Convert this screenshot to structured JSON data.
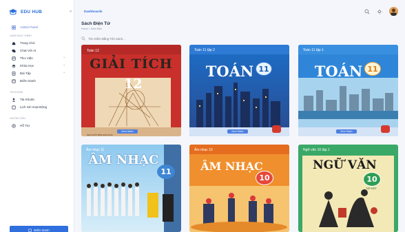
{
  "brand": {
    "name": "EDU HUB"
  },
  "topbar": {
    "breadcrumb": "Dashboards"
  },
  "sidebar": {
    "admin": "Admin Panel",
    "section_main": "DANH MỤC CHÍNH",
    "items": [
      {
        "label": "Trang Chủ",
        "icon": "home-icon"
      },
      {
        "label": "Chat Với AI",
        "icon": "chat-icon"
      },
      {
        "label": "Thư Viện",
        "icon": "library-icon"
      },
      {
        "label": "Khóa Học",
        "icon": "course-icon"
      },
      {
        "label": "Bài Tập",
        "icon": "exercise-icon"
      },
      {
        "label": "Điểm Danh",
        "icon": "attendance-icon"
      }
    ],
    "section_account": "TÀI KHOẢN",
    "account_items": [
      {
        "label": "Tài Khoản",
        "icon": "user-icon"
      },
      {
        "label": "Lịch Sử Hoạt Động",
        "icon": "history-icon"
      }
    ],
    "section_support": "HƯỚNG DẪN",
    "support_items": [
      {
        "label": "Hỗ Trợ",
        "icon": "help-icon"
      }
    ],
    "bottom_button": "Điểm Danh"
  },
  "main": {
    "title": "Sách Điện Tử",
    "breadcrumb": "Home  >  Sách Điện",
    "search_placeholder": "Tìm Kiếm Bằng Tên Sách..."
  },
  "books": [
    {
      "tag": "Toán 12",
      "title": "GIẢI TÍCH",
      "number": "12",
      "button": "Xem Sách",
      "publisher": "NHÀ XUẤT BẢN GIÁO DỤC"
    },
    {
      "tag": "Toán 11 tập 2",
      "title": "TOÁN",
      "number": "11",
      "button": "Xem Sách"
    },
    {
      "tag": "Toán 11 tập 1",
      "title": "TOÁN",
      "number": "11",
      "button": "Xem Sách"
    },
    {
      "tag": "Âm nhạc 11",
      "title": "ÂM NHẠC",
      "number": "11"
    },
    {
      "tag": "Âm nhạc 10",
      "title": "ÂM NHẠC",
      "number": "10"
    },
    {
      "tag": "Ngữ văn 10 tập 1",
      "title": "NGỮ VĂN",
      "number": "10",
      "subtitle": "TẬP MỘT"
    }
  ],
  "colors": {
    "accent": "#2f6fde",
    "sidebar_bg": "#ffffff",
    "page_bg": "#f4f6fb"
  }
}
